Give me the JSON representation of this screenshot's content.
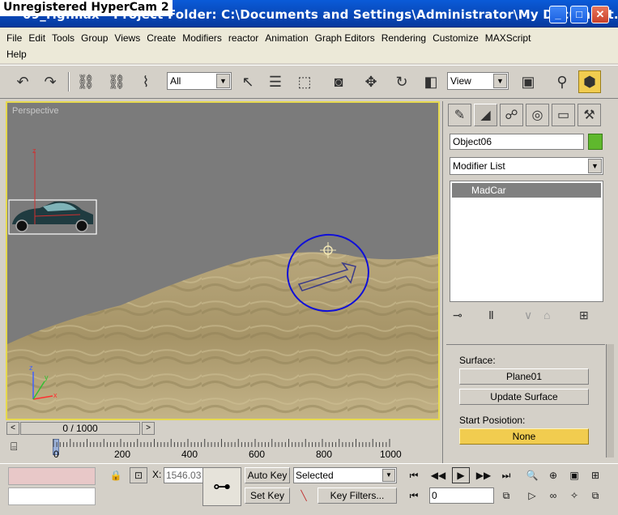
{
  "overlay": {
    "watermark": "Unregistered HyperCam 2"
  },
  "window": {
    "title": "09_rig.max - Project Folder: C:\\Documents and Settings\\Administrator\\My Document...",
    "controls": {
      "minimize": "_",
      "maximize": "□",
      "close": "✕"
    }
  },
  "menu": [
    "File",
    "Edit",
    "Tools",
    "Group",
    "Views",
    "Create",
    "Modifiers",
    "reactor",
    "Animation",
    "Graph Editors",
    "Rendering",
    "Customize",
    "MAXScript",
    "Help"
  ],
  "toolbar": {
    "selection_filter": "All",
    "ref_coord": "View"
  },
  "viewport": {
    "label": "Perspective"
  },
  "timeline": {
    "frame_display": "0 / 1000",
    "ticks": [
      "0",
      "200",
      "400",
      "600",
      "800",
      "1000"
    ]
  },
  "command_panel": {
    "object_name": "Object06",
    "modifier_list": "Modifier List",
    "stack_items": [
      "MadCar"
    ],
    "surface_label": "Surface:",
    "surface_button": "Plane01",
    "update_button": "Update Surface",
    "start_position_label": "Start Posiotion:",
    "none_button": "None"
  },
  "status": {
    "x_label": "X:",
    "x_value": "1546.03",
    "auto_key": "Auto Key",
    "set_key": "Set Key",
    "key_mode": "Selected",
    "key_filters": "Key Filters...",
    "current_frame": "0"
  },
  "colors": {
    "object_color": "#5fb82d",
    "active_viewport_border": "#e6d94e",
    "start_position_highlight": "#f1cc4f"
  }
}
